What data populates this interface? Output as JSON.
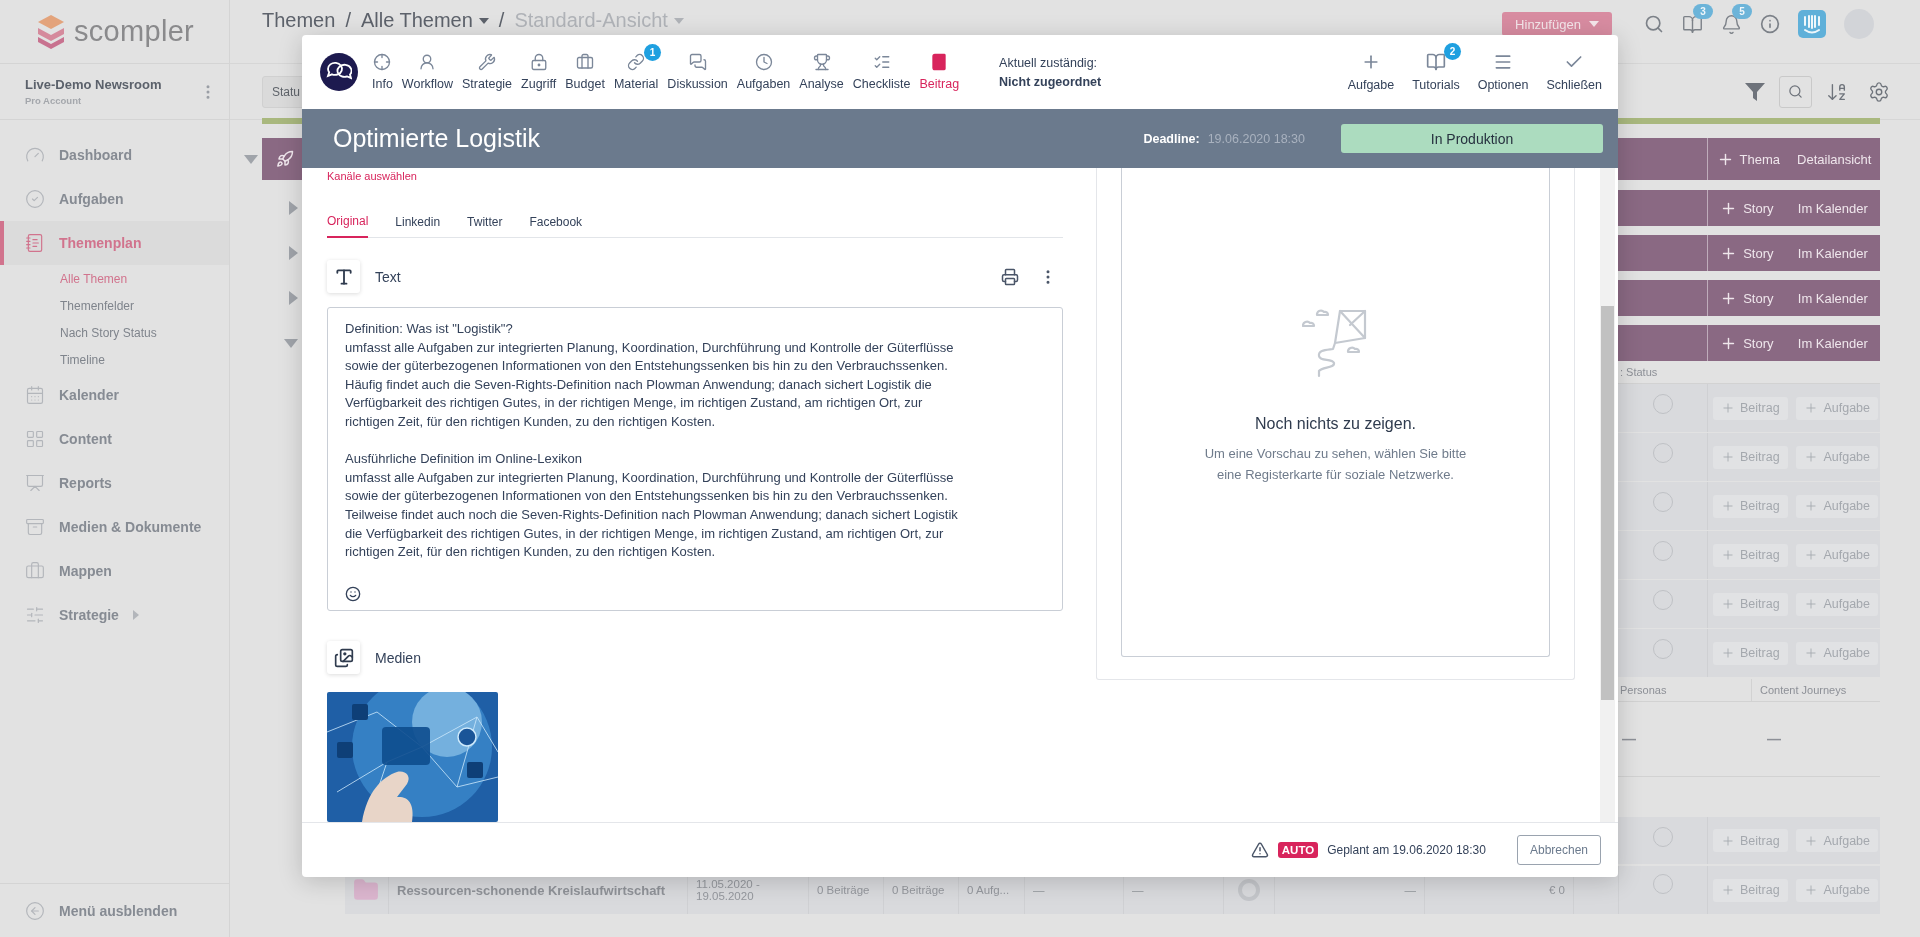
{
  "app": {
    "logo": "scompler"
  },
  "account": {
    "name": "Live-Demo Newsroom",
    "plan": "Pro Account"
  },
  "sidebar": {
    "items": [
      {
        "label": "Dashboard",
        "selected": false,
        "submenu": false
      },
      {
        "label": "Aufgaben",
        "selected": false,
        "submenu": false
      },
      {
        "label": "Themenplan",
        "selected": true,
        "submenu": false,
        "children": [
          {
            "label": "Alle Themen",
            "selected": true
          },
          {
            "label": "Themenfelder",
            "selected": false
          },
          {
            "label": "Nach Story Status",
            "selected": false
          },
          {
            "label": "Timeline",
            "selected": false
          }
        ]
      },
      {
        "label": "Kalender",
        "selected": false,
        "submenu": false
      },
      {
        "label": "Content",
        "selected": false,
        "submenu": false
      },
      {
        "label": "Reports",
        "selected": false,
        "submenu": false
      },
      {
        "label": "Medien & Dokumente",
        "selected": false,
        "submenu": false
      },
      {
        "label": "Mappen",
        "selected": false,
        "submenu": false
      },
      {
        "label": "Strategie",
        "selected": false,
        "submenu": true
      }
    ],
    "hide_menu": "Menü ausblenden"
  },
  "breadcrumb": {
    "separator": "/",
    "items": [
      {
        "label": "Themen",
        "dropdown": false,
        "current": false
      },
      {
        "label": "Alle Themen",
        "dropdown": true,
        "current": false
      },
      {
        "label": "Standard-Ansicht",
        "dropdown": true,
        "current": true
      }
    ]
  },
  "header": {
    "add_button": "Hinzufügen",
    "tutorials_badge": "3",
    "notifications_badge": "5"
  },
  "status_filter": {
    "label": "Statu"
  },
  "table": {
    "topic": {
      "expanded": true,
      "add_label": "Thema",
      "view_label": "Detailansicht"
    },
    "stories": [
      {
        "expanded": false,
        "add_label": "Story",
        "view_label": "Im Kalender"
      },
      {
        "expanded": false,
        "add_label": "Story",
        "view_label": "Im Kalender"
      },
      {
        "expanded": false,
        "add_label": "Story",
        "view_label": "Im Kalender"
      },
      {
        "expanded": true,
        "add_label": "Story",
        "view_label": "Im Kalender"
      }
    ],
    "status_header": ": Status",
    "post_rows": [
      {
        "add_post": "Beitrag",
        "add_task": "Aufgabe"
      },
      {
        "add_post": "Beitrag",
        "add_task": "Aufgabe"
      },
      {
        "add_post": "Beitrag",
        "add_task": "Aufgabe"
      },
      {
        "add_post": "Beitrag",
        "add_task": "Aufgabe"
      },
      {
        "add_post": "Beitrag",
        "add_task": "Aufgabe"
      },
      {
        "add_post": "Beitrag",
        "add_task": "Aufgabe"
      }
    ],
    "columns": [
      "Personas",
      "Content Journeys"
    ],
    "empty_cells": [
      "—",
      "—"
    ],
    "more_rows": [
      {
        "add_post": "Beitrag",
        "add_task": "Aufgabe"
      }
    ],
    "bottom_topic": {
      "title": "Ressourcen-schonende Kreislaufwirtschaft",
      "dates": "11.05.2020 -\n19.05.2020",
      "cells": [
        "0 Beiträge",
        "0 Beiträge",
        "0 Aufg...",
        "—",
        "—"
      ],
      "cells_after": [
        "—",
        "€ 0"
      ],
      "add_post": "Beitrag",
      "add_task": "Aufgabe"
    }
  },
  "modal": {
    "tabs": [
      {
        "label": "Info",
        "selected": false
      },
      {
        "label": "Workflow",
        "selected": false
      },
      {
        "label": "Strategie",
        "selected": false
      },
      {
        "label": "Zugriff",
        "selected": false
      },
      {
        "label": "Budget",
        "selected": false
      },
      {
        "label": "Material",
        "selected": false,
        "badge": "1"
      },
      {
        "label": "Diskussion",
        "selected": false
      },
      {
        "label": "Aufgaben",
        "selected": false
      },
      {
        "label": "Analyse",
        "selected": false
      },
      {
        "label": "Checkliste",
        "selected": false
      },
      {
        "label": "Beitrag",
        "selected": true
      }
    ],
    "assignee": {
      "label": "Aktuell zuständig:",
      "value": "Nicht zugeordnet"
    },
    "actions": [
      {
        "label": "Aufgabe"
      },
      {
        "label": "Tutorials",
        "badge": "2"
      },
      {
        "label": "Optionen"
      },
      {
        "label": "Schließen"
      }
    ],
    "title": "Optimierte Logistik",
    "deadline_label": "Deadline:",
    "deadline": "19.06.2020 18:30",
    "status": "In Produktion",
    "channels_link": "Kanäle auswählen",
    "channel_tabs": [
      {
        "label": "Original",
        "selected": true
      },
      {
        "label": "Linkedin",
        "selected": false
      },
      {
        "label": "Twitter",
        "selected": false
      },
      {
        "label": "Facebook",
        "selected": false
      }
    ],
    "text_section": {
      "title": "Text",
      "content": "Definition: Was ist \"Logistik\"?\numfasst alle Aufgaben zur integrierten Planung, Koordination, Durchführung und Kontrolle der Güterflüsse\nsowie der güterbezogenen Informationen von den Entstehungssenken bis hin zu den Verbrauchssenken.\nHäufig findet auch die Seven-Rights-Definition nach Plowman Anwendung; danach sichert Logistik die\nVerfügbarkeit des richtigen Gutes, in der richtigen Menge, im richtigen Zustand, am richtigen Ort, zur\nrichtigen Zeit, für den richtigen Kunden, zu den richtigen Kosten.\n\nAusführliche Definition im Online-Lexikon\numfasst alle Aufgaben zur integrierten Planung, Koordination, Durchführung und Kontrolle der Güterflüsse\nsowie der güterbezogenen Informationen von den Entstehungssenken bis hin zu den Verbrauchssenken.\nTeilweise findet auch noch die Seven-Rights-Definition nach Plowman Anwendung; danach sichert Logistik\ndie Verfügbarkeit des richtigen Gutes, in der richtigen Menge, im richtigen Zustand, am richtigen Ort, zur\nrichtigen Zeit, für den richtigen Kunden, zu den richtigen Kosten."
    },
    "media_section": {
      "title": "Medien"
    },
    "preview": {
      "title": "Noch nichts zu zeigen.",
      "description": "Um eine Vorschau zu sehen, wählen Sie bitte\neine Registerkarte für soziale Netzwerke."
    },
    "footer": {
      "auto_badge": "AUTO",
      "schedule": "Geplant am 19.06.2020 18:30",
      "cancel": "Abbrechen"
    }
  }
}
